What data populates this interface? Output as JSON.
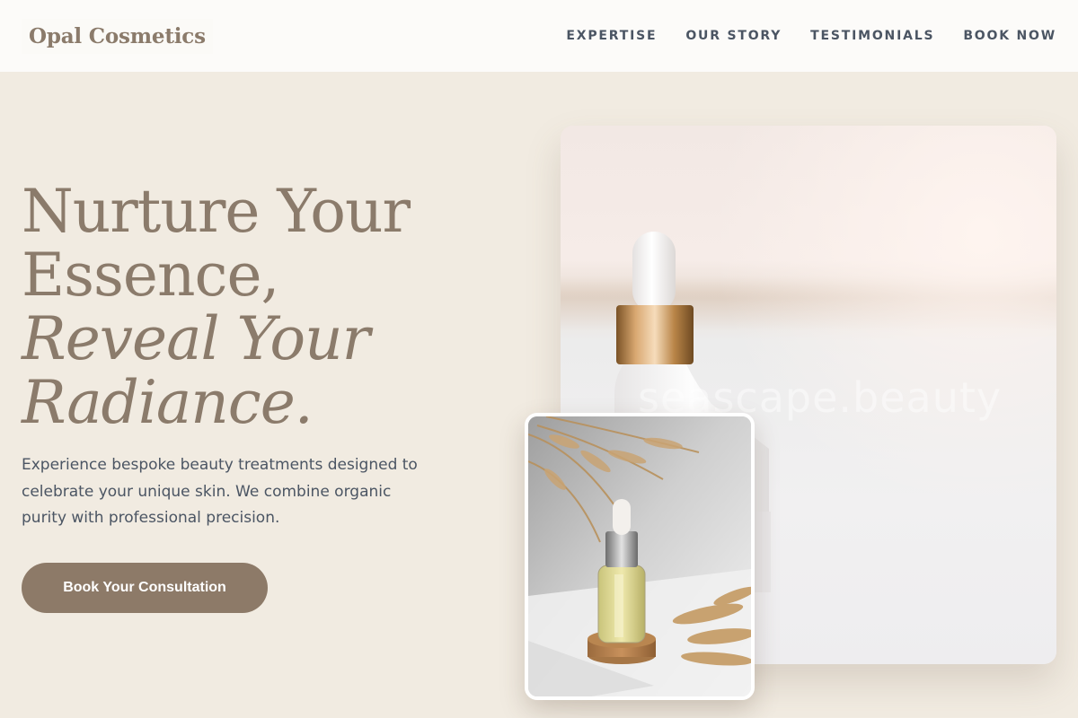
{
  "header": {
    "logo": "Opal Cosmetics",
    "nav": [
      {
        "label": "EXPERTISE"
      },
      {
        "label": "OUR STORY"
      },
      {
        "label": "TESTIMONIALS"
      },
      {
        "label": "BOOK NOW"
      }
    ]
  },
  "hero": {
    "title_lines": [
      "Nurture Your",
      "Essence,"
    ],
    "title_italic_lines": [
      "Reveal Your",
      "Radiance."
    ],
    "description": "Experience bespoke beauty treatments designed to celebrate your unique skin. We combine organic purity with professional precision.",
    "cta_label": "Book Your Consultation",
    "main_image": {
      "watermark": "seascape.beauty"
    }
  },
  "colors": {
    "page_background": "#f1ebe1",
    "header_background": "#fcfbf9",
    "accent": "#8d7a68",
    "heading": "#8b7b6b",
    "body_text": "#4b5563"
  },
  "icons": [
    "dropper-bottle-illustration",
    "serum-bottle-illustration",
    "dried-pampas-grass"
  ]
}
